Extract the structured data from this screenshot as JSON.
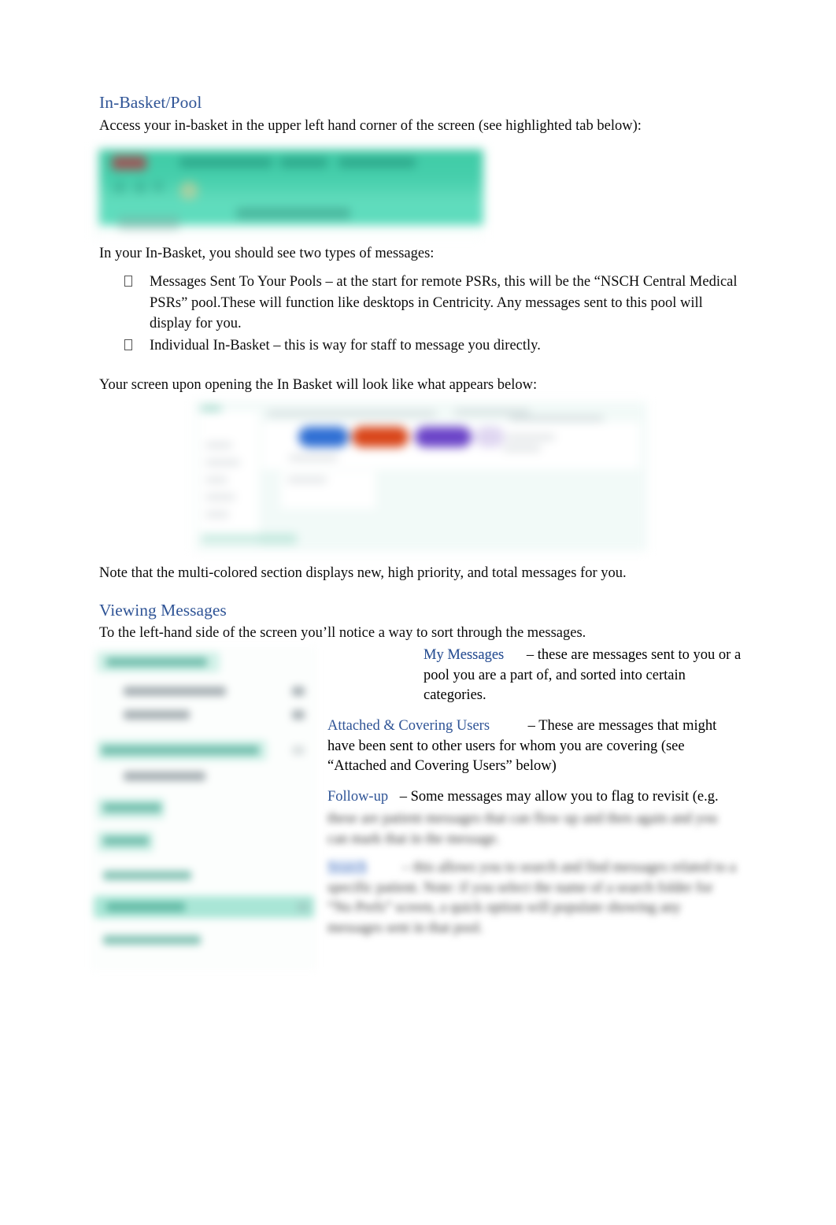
{
  "document": {
    "title": "In-Basket/Pool",
    "sections": [
      {
        "heading": "In-Basket/Pool",
        "intro": "Access your in-basket in the upper left hand corner of the screen (see highlighted tab below):",
        "after_image_intro": "In your In-Basket, you should see two types of messages:",
        "bullets": [
          "Messages Sent To Your Pools  – at the start for remote PSRs, this will be the “NSCH Central Medical PSRs” pool.These will function like desktops in Centricity. Any messages sent to this pool will display for you.",
          "Individual In-Basket – this is way for staff to message you directly."
        ],
        "screen_intro": "Your screen upon opening the In Basket will look like what appears below:",
        "note": "Note that the multi-colored section displays new, high priority, and total messages for you."
      },
      {
        "heading": "Viewing Messages",
        "intro": "To the left-hand side of the screen you’ll notice a way to sort through the messages.",
        "items": [
          {
            "term": "My Messages",
            "description": "– these are messages sent to you or a pool you are a part of, and sorted into certain categories."
          },
          {
            "term": "Attached & Covering Users",
            "description": "– These are messages that might have been sent to other users for whom you are covering (see “Attached and Covering Users” below)"
          },
          {
            "term": "Follow-up",
            "description": "– Some messages may allow you to flag to revisit (e.g."
          }
        ],
        "obscured": {
          "paragraph_1": "these are patient messages that can flow up and then again and you can mark that in the message.",
          "paragraph_2_term": "Search",
          "paragraph_2": "– this allows you to search and find messages related to a specific patient. Note: if you select the name of a search folder for “No Prefs” screen, a quick option will populate showing any messages sent in that pool."
        }
      }
    ],
    "colors": {
      "heading_blue": "#2F5496",
      "body_text": "#0c0c0c",
      "screenshot_teal": "#46cfac",
      "pill_blue": "#2f6fd4",
      "pill_orange": "#d9461a",
      "pill_purple": "#6b44c8",
      "epic_button": "#9a5a5a"
    },
    "images": [
      {
        "name": "epic-toolbar-screenshot",
        "alt": "Blurred Epic toolbar screenshot with highlighted In Basket tab"
      },
      {
        "name": "in-basket-landing-screenshot",
        "alt": "Blurred In Basket landing screen with colored message count pills"
      },
      {
        "name": "message-folder-sidebar-screenshot",
        "alt": "Blurred message folder sidebar screenshot"
      }
    ]
  }
}
